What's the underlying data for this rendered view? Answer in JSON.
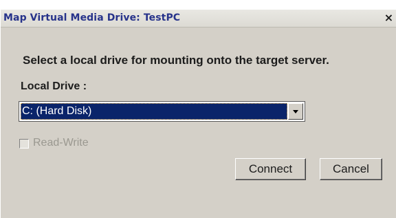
{
  "window": {
    "title": "Map Virtual Media Drive: TestPC",
    "close_glyph": "×",
    "close_icon": "close-icon"
  },
  "content": {
    "instruction": "Select a local drive for mounting onto the target server.",
    "drive_label": "Local Drive :",
    "drive_select": {
      "selected": "C: (Hard Disk)",
      "arrow_icon": "chevron-down-icon"
    },
    "read_write": {
      "label": "Read-Write",
      "checked": false,
      "disabled": true
    }
  },
  "buttons": {
    "connect": "Connect",
    "cancel": "Cancel"
  },
  "colors": {
    "dialog_bg": "#d4d0c8",
    "title_text": "#27338b",
    "selection_bg": "#0a246a",
    "disabled_text": "#9a9890"
  }
}
